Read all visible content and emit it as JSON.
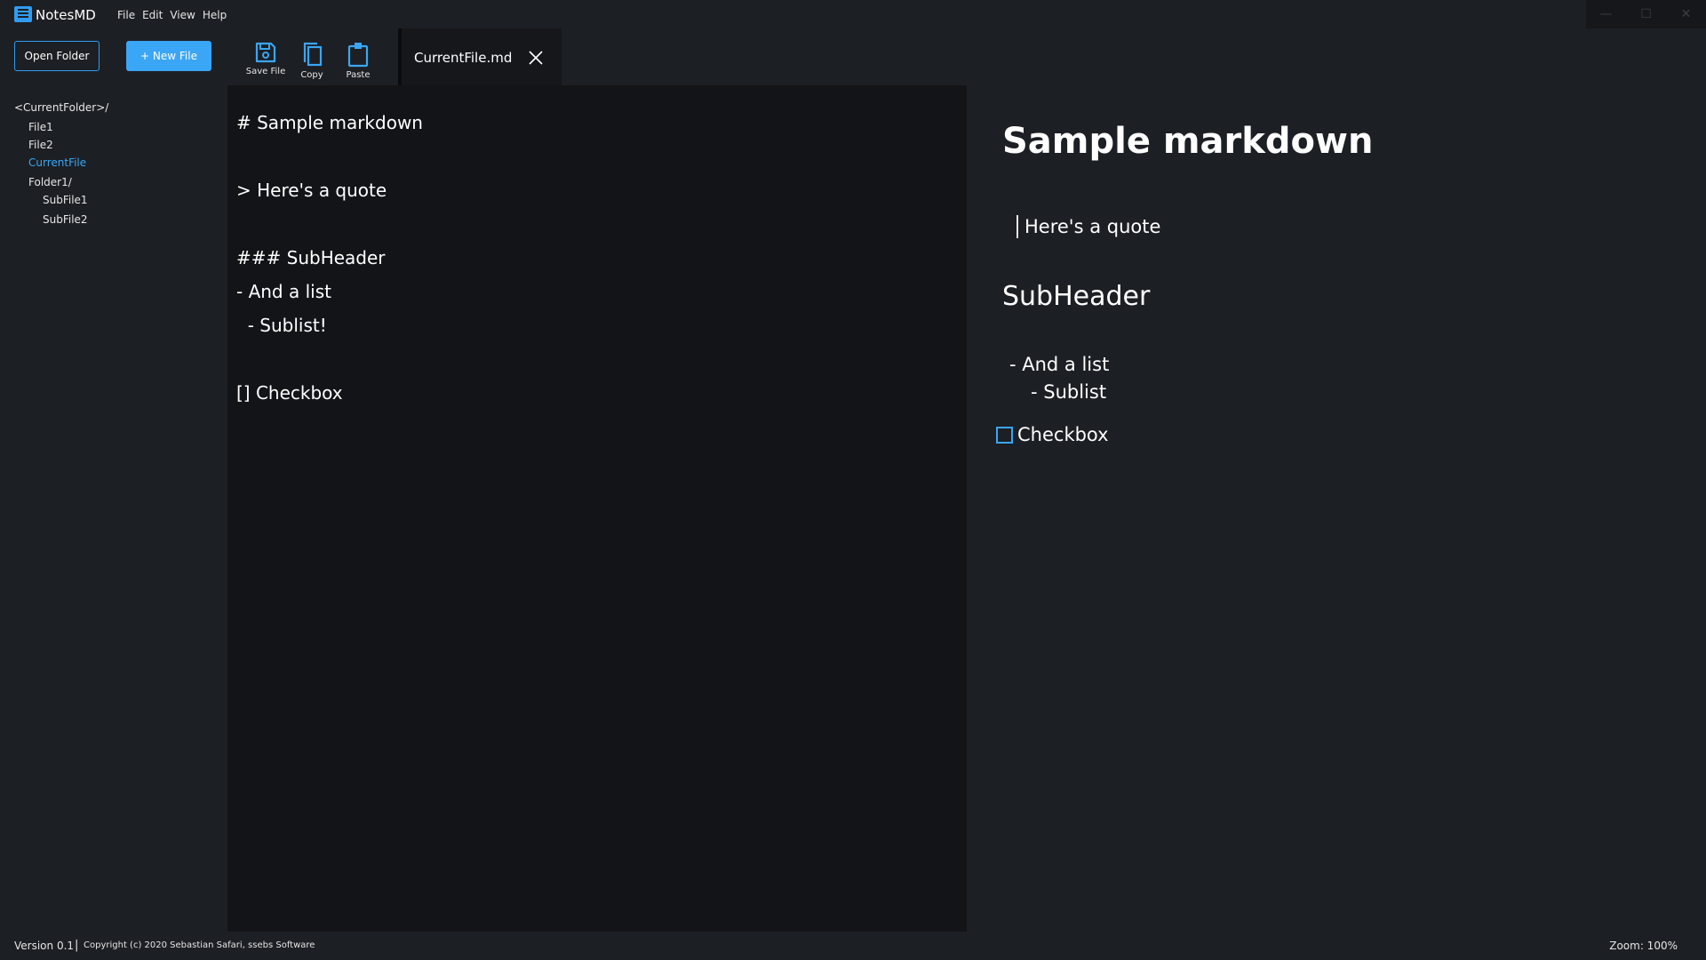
{
  "app": {
    "title": "NotesMD"
  },
  "menu": [
    "File",
    "Edit",
    "View",
    "Help"
  ],
  "window_controls": {
    "minimize": "—",
    "maximize": "☐",
    "close": "✕"
  },
  "sidebar": {
    "open_folder": "Open Folder",
    "new_file": "+ New File",
    "tree": [
      {
        "label": "<CurrentFolder>/",
        "depth": 0,
        "active": false
      },
      {
        "label": "File1",
        "depth": 1,
        "active": false
      },
      {
        "label": "File2",
        "depth": 1,
        "active": false
      },
      {
        "label": "CurrentFile",
        "depth": 1,
        "active": true
      },
      {
        "label": "Folder1/",
        "depth": 1,
        "active": false
      },
      {
        "label": "SubFile1",
        "depth": 2,
        "active": false
      },
      {
        "label": "SubFile2",
        "depth": 2,
        "active": false
      }
    ]
  },
  "toolbar": {
    "save": "Save File",
    "copy": "Copy",
    "paste": "Paste",
    "tab_title": "CurrentFile.md"
  },
  "editor": {
    "lines": [
      "# Sample markdown",
      "> Here's a quote",
      "### SubHeader",
      "- And a list",
      "  - Sublist!",
      "[] Checkbox"
    ]
  },
  "preview": {
    "h1": "Sample markdown",
    "quote": "Here's a quote",
    "h3": "SubHeader",
    "list_item": "- And a list",
    "sublist_item": "- Sublist",
    "checkbox_label": "Checkbox",
    "checkbox_checked": false
  },
  "status": {
    "version": "Version 0.1",
    "separator": "|",
    "copyright": "Copyright (c) 2020 Sebastian Safari, ssebs Software",
    "zoom": "Zoom: 100%"
  },
  "colors": {
    "accent": "#3aa6f5",
    "editor_bg": "#121417",
    "panel_bg": "#1c1f24"
  }
}
